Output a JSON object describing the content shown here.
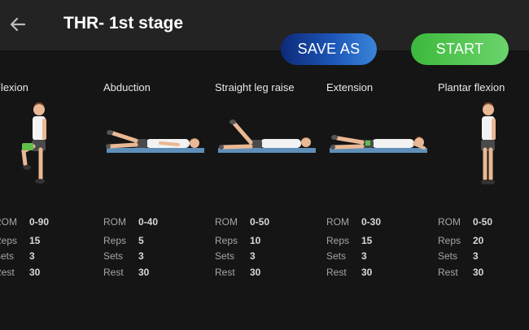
{
  "header": {
    "title": "THR- 1st stage",
    "back_icon": "arrow-left-icon"
  },
  "actions": {
    "save_as_label": "SAVE AS",
    "start_label": "START"
  },
  "exercises": [
    {
      "name": "Flexion",
      "stats": [
        {
          "label": "ROM",
          "value": "0-90"
        },
        {
          "label": "Reps",
          "value": "15"
        },
        {
          "label": "Sets",
          "value": "3"
        },
        {
          "label": "Rest",
          "value": "30"
        }
      ]
    },
    {
      "name": "Abduction",
      "stats": [
        {
          "label": "ROM",
          "value": "0-40"
        },
        {
          "label": "Reps",
          "value": "5"
        },
        {
          "label": "Sets",
          "value": "3"
        },
        {
          "label": "Rest",
          "value": "30"
        }
      ]
    },
    {
      "name": "Straight leg raise",
      "stats": [
        {
          "label": "ROM",
          "value": "0-50"
        },
        {
          "label": "Reps",
          "value": "10"
        },
        {
          "label": "Sets",
          "value": "3"
        },
        {
          "label": "Rest",
          "value": "30"
        }
      ]
    },
    {
      "name": "Extension",
      "stats": [
        {
          "label": "ROM",
          "value": "0-30"
        },
        {
          "label": "Reps",
          "value": "15"
        },
        {
          "label": "Sets",
          "value": "3"
        },
        {
          "label": "Rest",
          "value": "30"
        }
      ]
    },
    {
      "name": "Plantar flexion",
      "stats": [
        {
          "label": "ROM",
          "value": "0-50"
        },
        {
          "label": "Reps",
          "value": "20"
        },
        {
          "label": "Sets",
          "value": "3"
        },
        {
          "label": "Rest",
          "value": "30"
        }
      ]
    }
  ],
  "colors": {
    "header_bg": "#232323",
    "page_bg": "#151515",
    "save_as": "#1d57b8",
    "start": "#5cc95c",
    "mat": "#5f8fb8"
  }
}
